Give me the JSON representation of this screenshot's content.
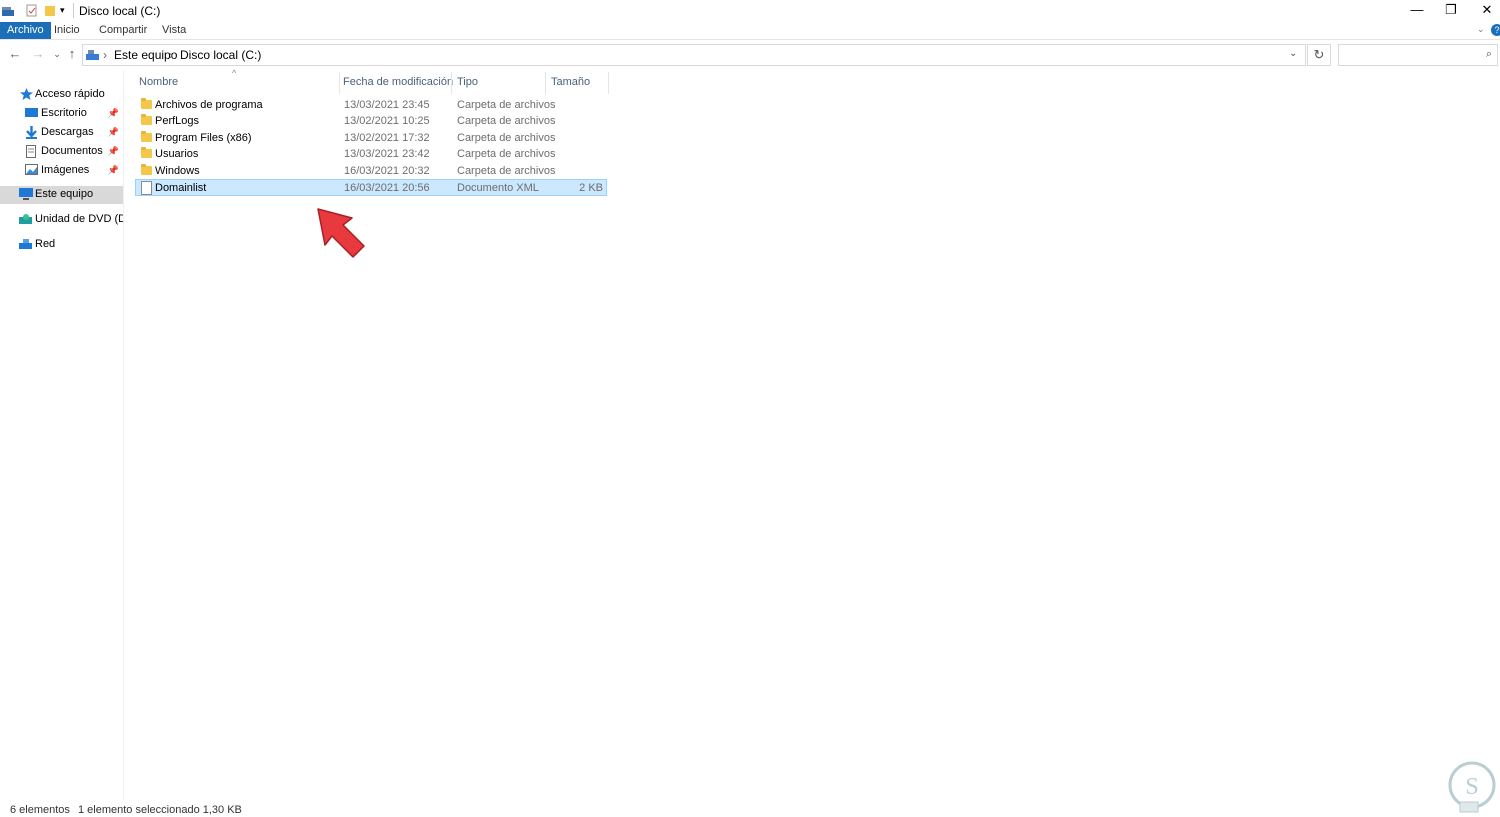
{
  "window": {
    "title": "Disco local (C:)"
  },
  "window_controls": {
    "minimize": "—",
    "restore": "❐",
    "close": "✕"
  },
  "ribbon": {
    "tabs": [
      "Archivo",
      "Inicio",
      "Compartir",
      "Vista"
    ]
  },
  "address": {
    "segments": [
      "Este equipo",
      "Disco local (C:)"
    ],
    "separator": "›"
  },
  "search": {
    "placeholder": ""
  },
  "sidebar": {
    "items": [
      {
        "label": "Acceso rápido",
        "icon": "star-icon",
        "pinned": false
      },
      {
        "label": "Escritorio",
        "icon": "desktop-icon",
        "pinned": true
      },
      {
        "label": "Descargas",
        "icon": "download-icon",
        "pinned": true
      },
      {
        "label": "Documentos",
        "icon": "documents-icon",
        "pinned": true
      },
      {
        "label": "Imágenes",
        "icon": "pictures-icon",
        "pinned": true
      },
      {
        "label": "Este equipo",
        "icon": "computer-icon",
        "pinned": false,
        "selected": true
      },
      {
        "label": "Unidad de DVD (D:) S",
        "icon": "dvd-icon",
        "pinned": false
      },
      {
        "label": "Red",
        "icon": "network-icon",
        "pinned": false
      }
    ]
  },
  "columns": {
    "name": "Nombre",
    "date": "Fecha de modificación",
    "type": "Tipo",
    "size": "Tamaño"
  },
  "files": [
    {
      "name": "Archivos de programa",
      "date": "13/03/2021 23:45",
      "type": "Carpeta de archivos",
      "size": "",
      "kind": "folder"
    },
    {
      "name": "PerfLogs",
      "date": "13/02/2021 10:25",
      "type": "Carpeta de archivos",
      "size": "",
      "kind": "folder"
    },
    {
      "name": "Program Files (x86)",
      "date": "13/02/2021 17:32",
      "type": "Carpeta de archivos",
      "size": "",
      "kind": "folder"
    },
    {
      "name": "Usuarios",
      "date": "13/03/2021 23:42",
      "type": "Carpeta de archivos",
      "size": "",
      "kind": "folder"
    },
    {
      "name": "Windows",
      "date": "16/03/2021 20:32",
      "type": "Carpeta de archivos",
      "size": "",
      "kind": "folder"
    },
    {
      "name": "Domainlist",
      "date": "16/03/2021 20:56",
      "type": "Documento XML",
      "size": "2 KB",
      "kind": "xml",
      "selected": true
    }
  ],
  "status": {
    "count": "6 elementos",
    "selection": "1 elemento seleccionado  1,30 KB"
  },
  "colors": {
    "accent": "#1a6fb8",
    "selection": "#cce8ff",
    "arrow": "#e8393f"
  }
}
